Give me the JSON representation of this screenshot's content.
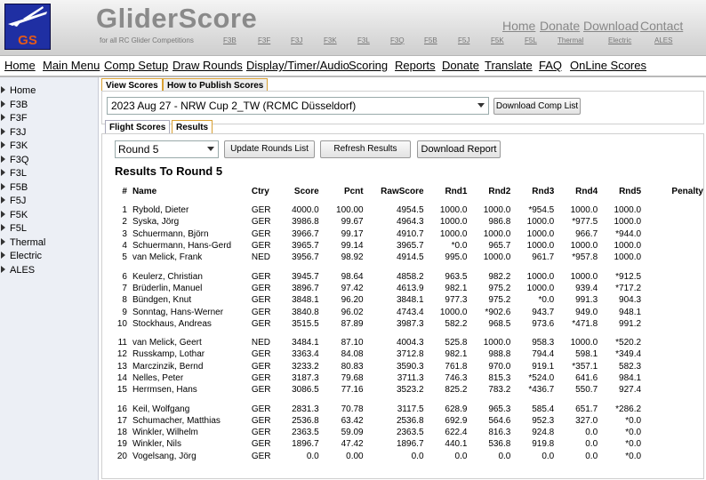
{
  "header": {
    "title": "GliderScore",
    "tagline": "for all RC Glider Competitions",
    "logo_text": "GS",
    "categories": [
      "F3B",
      "F3F",
      "F3J",
      "F3K",
      "F3L",
      "F3Q",
      "F5B",
      "F5J",
      "F5K",
      "F5L",
      "Thermal",
      "Electric",
      "ALES"
    ],
    "top_links": [
      "Home",
      "Donate",
      "Download",
      "Contact"
    ]
  },
  "menu": [
    "Home",
    "Main Menu",
    "Comp Setup",
    "Draw Rounds",
    "Display/Timer/Audio",
    "Scoring",
    "Reports",
    "Donate",
    "Translate",
    "FAQ",
    "OnLine Scores"
  ],
  "sidebar": [
    "Home",
    "F3B",
    "F3F",
    "F3J",
    "F3K",
    "F3Q",
    "F3L",
    "F5B",
    "F5J",
    "F5K",
    "F5L",
    "Thermal",
    "Electric",
    "ALES"
  ],
  "tabs": {
    "view_scores": "View Scores",
    "how_to_publish": "How to Publish Scores",
    "flight_scores": "Flight Scores",
    "results": "Results"
  },
  "competition_select": "2023 Aug 27 - NRW Cup 2_TW (RCMC Düsseldorf)",
  "buttons": {
    "download_comp_list": "Download Comp List",
    "update_rounds_list": "Update Rounds List",
    "refresh_results": "Refresh Results",
    "download_report": "Download Report"
  },
  "round_select": "Round 5",
  "results_title": "Results To Round 5",
  "columns": [
    "#",
    "Name",
    "Ctry",
    "Score",
    "Pcnt",
    "RawScore",
    "Rnd1",
    "Rnd2",
    "Rnd3",
    "Rnd4",
    "Rnd5",
    "Penalty"
  ],
  "rows": [
    [
      "1",
      "Rybold, Dieter",
      "GER",
      "4000.0",
      "100.00",
      "4954.5",
      "1000.0",
      "1000.0",
      "*954.5",
      "1000.0",
      "1000.0",
      ""
    ],
    [
      "2",
      "Syska, Jörg",
      "GER",
      "3986.8",
      "99.67",
      "4964.3",
      "1000.0",
      "986.8",
      "1000.0",
      "*977.5",
      "1000.0",
      ""
    ],
    [
      "3",
      "Schuermann, Björn",
      "GER",
      "3966.7",
      "99.17",
      "4910.7",
      "1000.0",
      "1000.0",
      "1000.0",
      "966.7",
      "*944.0",
      ""
    ],
    [
      "4",
      "Schuermann, Hans-Gerd",
      "GER",
      "3965.7",
      "99.14",
      "3965.7",
      "*0.0",
      "965.7",
      "1000.0",
      "1000.0",
      "1000.0",
      ""
    ],
    [
      "5",
      "van Melick, Frank",
      "NED",
      "3956.7",
      "98.92",
      "4914.5",
      "995.0",
      "1000.0",
      "961.7",
      "*957.8",
      "1000.0",
      ""
    ],
    [
      "6",
      "Keulerz, Christian",
      "GER",
      "3945.7",
      "98.64",
      "4858.2",
      "963.5",
      "982.2",
      "1000.0",
      "1000.0",
      "*912.5",
      ""
    ],
    [
      "7",
      "Brüderlin, Manuel",
      "GER",
      "3896.7",
      "97.42",
      "4613.9",
      "982.1",
      "975.2",
      "1000.0",
      "939.4",
      "*717.2",
      ""
    ],
    [
      "8",
      "Bündgen, Knut",
      "GER",
      "3848.1",
      "96.20",
      "3848.1",
      "977.3",
      "975.2",
      "*0.0",
      "991.3",
      "904.3",
      ""
    ],
    [
      "9",
      "Sonntag, Hans-Werner",
      "GER",
      "3840.8",
      "96.02",
      "4743.4",
      "1000.0",
      "*902.6",
      "943.7",
      "949.0",
      "948.1",
      ""
    ],
    [
      "10",
      "Stockhaus, Andreas",
      "GER",
      "3515.5",
      "87.89",
      "3987.3",
      "582.2",
      "968.5",
      "973.6",
      "*471.8",
      "991.2",
      ""
    ],
    [
      "11",
      "van Melick, Geert",
      "NED",
      "3484.1",
      "87.10",
      "4004.3",
      "525.8",
      "1000.0",
      "958.3",
      "1000.0",
      "*520.2",
      ""
    ],
    [
      "12",
      "Russkamp, Lothar",
      "GER",
      "3363.4",
      "84.08",
      "3712.8",
      "982.1",
      "988.8",
      "794.4",
      "598.1",
      "*349.4",
      ""
    ],
    [
      "13",
      "Marczinzik, Bernd",
      "GER",
      "3233.2",
      "80.83",
      "3590.3",
      "761.8",
      "970.0",
      "919.1",
      "*357.1",
      "582.3",
      ""
    ],
    [
      "14",
      "Nelles, Peter",
      "GER",
      "3187.3",
      "79.68",
      "3711.3",
      "746.3",
      "815.3",
      "*524.0",
      "641.6",
      "984.1",
      ""
    ],
    [
      "15",
      "Herrmsen, Hans",
      "GER",
      "3086.5",
      "77.16",
      "3523.2",
      "825.2",
      "783.2",
      "*436.7",
      "550.7",
      "927.4",
      ""
    ],
    [
      "16",
      "Keil, Wolfgang",
      "GER",
      "2831.3",
      "70.78",
      "3117.5",
      "628.9",
      "965.3",
      "585.4",
      "651.7",
      "*286.2",
      ""
    ],
    [
      "17",
      "Schumacher, Matthias",
      "GER",
      "2536.8",
      "63.42",
      "2536.8",
      "692.9",
      "564.6",
      "952.3",
      "327.0",
      "*0.0",
      ""
    ],
    [
      "18",
      "Winkler, Wilhelm",
      "GER",
      "2363.5",
      "59.09",
      "2363.5",
      "622.4",
      "816.3",
      "924.8",
      "0.0",
      "*0.0",
      ""
    ],
    [
      "19",
      "Winkler, Nils",
      "GER",
      "1896.7",
      "47.42",
      "1896.7",
      "440.1",
      "536.8",
      "919.8",
      "0.0",
      "*0.0",
      ""
    ],
    [
      "20",
      "Vogelsang, Jörg",
      "GER",
      "0.0",
      "0.00",
      "0.0",
      "0.0",
      "0.0",
      "0.0",
      "0.0",
      "*0.0",
      ""
    ]
  ],
  "colors": {
    "logo_bg": "#1f2fa3",
    "logo_text": "#e35a1a",
    "tab_active_border": "#d8a033"
  }
}
